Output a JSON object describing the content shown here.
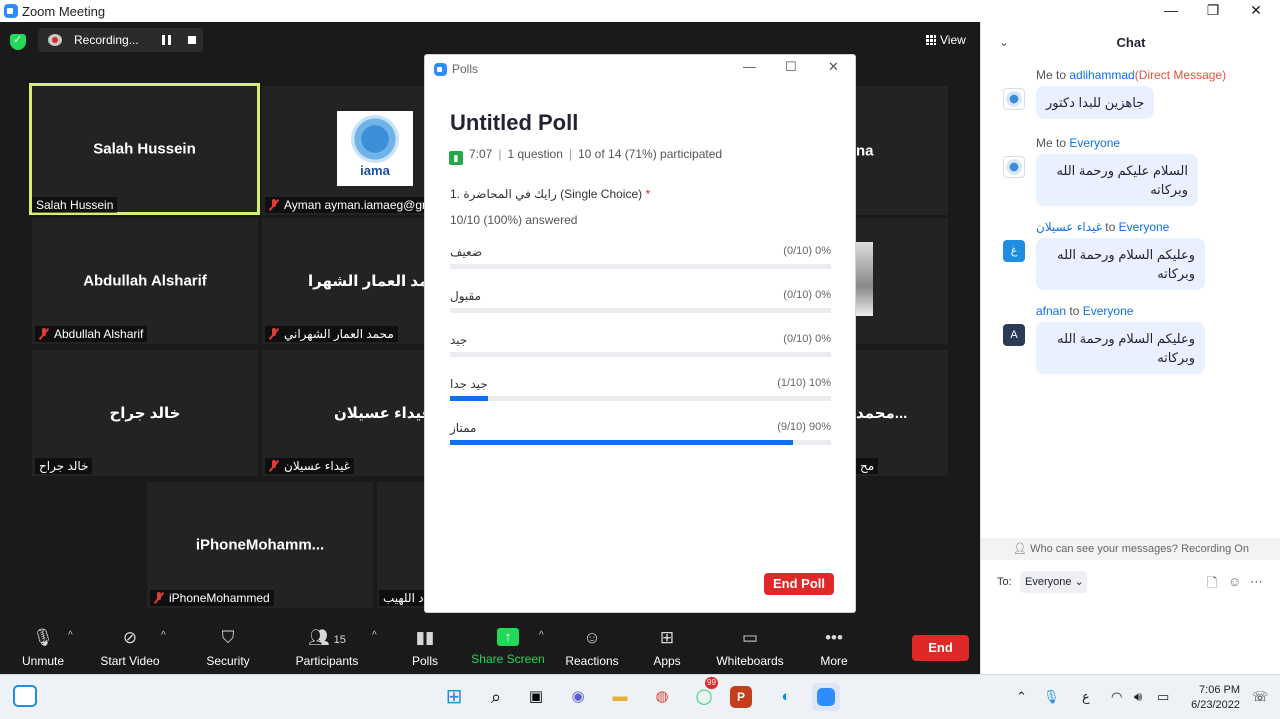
{
  "window": {
    "title": "Zoom Meeting",
    "minimize": "—",
    "maximize": "❐",
    "close": "✕"
  },
  "recording": {
    "label": "Recording..."
  },
  "view": {
    "label": "View"
  },
  "tiles": [
    {
      "name": "Salah Hussein",
      "label": "Salah Hussein",
      "muted": false,
      "active": true
    },
    {
      "name": "",
      "label": "Ayman ayman.iamaeg@gm",
      "muted": true,
      "logo_text": "iama"
    },
    {
      "name": "Abdullah Alsharif",
      "label": "Abdullah Alsharif",
      "muted": true
    },
    {
      "name": "محمد العمار الشهرا",
      "label": "محمد العمار الشهراني",
      "muted": true
    },
    {
      "name": "خالد جراح",
      "label": "خالد جراح",
      "muted": false
    },
    {
      "name": "غيداء عسيلان",
      "label": "غيداء عسيلان",
      "muted": true
    },
    {
      "name": "iPhoneMohamm...",
      "label": "iPhoneMohammed",
      "muted": true
    },
    {
      "name": "",
      "label": "د اللهيب",
      "muted": false
    },
    {
      "name": "na",
      "label": "",
      "muted": false
    },
    {
      "name": "محمد...",
      "label": "مح",
      "muted": false
    }
  ],
  "toolbar": {
    "unmute": "Unmute",
    "start_video": "Start Video",
    "security": "Security",
    "participants": "Participants",
    "participants_count": "15",
    "polls": "Polls",
    "share_screen": "Share Screen",
    "reactions": "Reactions",
    "apps": "Apps",
    "whiteboards": "Whiteboards",
    "more": "More",
    "end": "End"
  },
  "poll": {
    "window_title": "Polls",
    "title": "Untitled Poll",
    "time": "7:07",
    "questions": "1 question",
    "participated": "10 of 14 (71%) participated",
    "question": "1. رايك في المحاضرة (Single Choice)",
    "answered": "10/10 (100%) answered",
    "options": [
      {
        "label": "ضعيف",
        "value": "(0/10) 0%",
        "fraction": 0.0
      },
      {
        "label": "مقبول",
        "value": "(0/10) 0%",
        "fraction": 0.0
      },
      {
        "label": "جيد",
        "value": "(0/10) 0%",
        "fraction": 0.0
      },
      {
        "label": "جيد جدا",
        "value": "(1/10) 10%",
        "fraction": 0.1
      },
      {
        "label": "ممتاز",
        "value": "(9/10) 90%",
        "fraction": 0.9
      }
    ],
    "end_poll": "End Poll"
  },
  "chat": {
    "title": "Chat",
    "messages": [
      {
        "from_prefix": "Me to ",
        "from_target": "adlihammad",
        "dm": "(Direct Message)",
        "text": "جاهزين للبدا دكتور",
        "avatar": ""
      },
      {
        "from_prefix": "Me to ",
        "from_target": "Everyone",
        "dm": "",
        "text": "السلام عليكم ورحمة الله وبركاته",
        "avatar": ""
      },
      {
        "from_prefix": "غيداء عسيلان",
        "from_target": "Everyone",
        "dm": "",
        "text": "وعليكم السلام ورحمة الله وبركاته",
        "avatar": "غ"
      },
      {
        "from_prefix": "afnan",
        "from_target": "Everyone",
        "dm": "",
        "text": "وعليكم السلام ورحمة الله وبركاته",
        "avatar": "A"
      }
    ],
    "to_word": " to ",
    "who_can_see": "Who can see your messages? Recording On",
    "to_label": "To:",
    "to_value": "Everyone"
  },
  "taskbar": {
    "time": "7:06 PM",
    "date": "6/23/2022",
    "whatsapp_badge": "99",
    "lang": "ع"
  },
  "colors": {
    "accent": "#0e71eb",
    "danger": "#e02828",
    "active_speaker": "#d5ef6f",
    "share_green": "#23d959"
  }
}
